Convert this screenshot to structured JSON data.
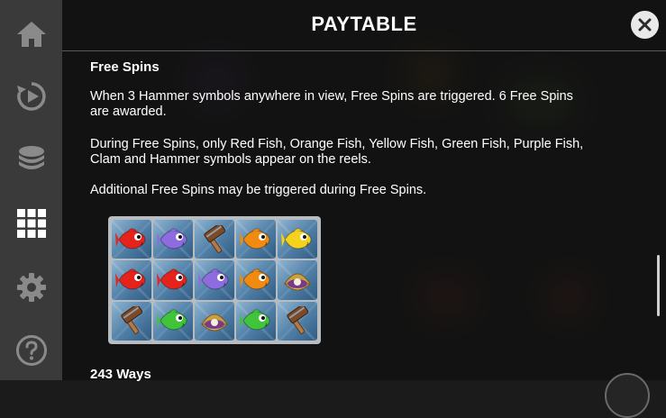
{
  "header": {
    "title": "PAYTABLE"
  },
  "sidebar": {
    "items": [
      {
        "icon": "home-icon"
      },
      {
        "icon": "autoplay-icon"
      },
      {
        "icon": "coin-stack-icon"
      },
      {
        "icon": "paytable-grid-icon",
        "active": true
      },
      {
        "icon": "gear-icon"
      },
      {
        "icon": "help-icon"
      }
    ]
  },
  "free_spins": {
    "title": "Free Spins",
    "para1": "When 3 Hammer symbols anywhere in view, Free Spins are triggered. 6 Free Spins are awarded.",
    "para2": "During Free Spins, only Red Fish, Orange Fish, Yellow Fish, Green Fish, Purple Fish, Clam and Hammer symbols appear on the reels.",
    "para3": "Additional Free Spins may be triggered during Free Spins."
  },
  "example_reels": [
    [
      "red-fish",
      "purple-fish",
      "hammer",
      "orange-fish",
      "yellow-fish"
    ],
    [
      "red-fish",
      "red-fish",
      "purple-fish",
      "orange-fish",
      "clam"
    ],
    [
      "hammer",
      "green-fish",
      "clam",
      "green-fish",
      "hammer"
    ]
  ],
  "next_section": {
    "title": "243 Ways"
  },
  "colors": {
    "red-fish": "#e5231b",
    "purple-fish": "#8f6be0",
    "orange-fish": "#f08a10",
    "yellow-fish": "#f5d21c",
    "green-fish": "#3fc43a",
    "clam": "#c9a040",
    "hammer": "#7a4a2a"
  }
}
